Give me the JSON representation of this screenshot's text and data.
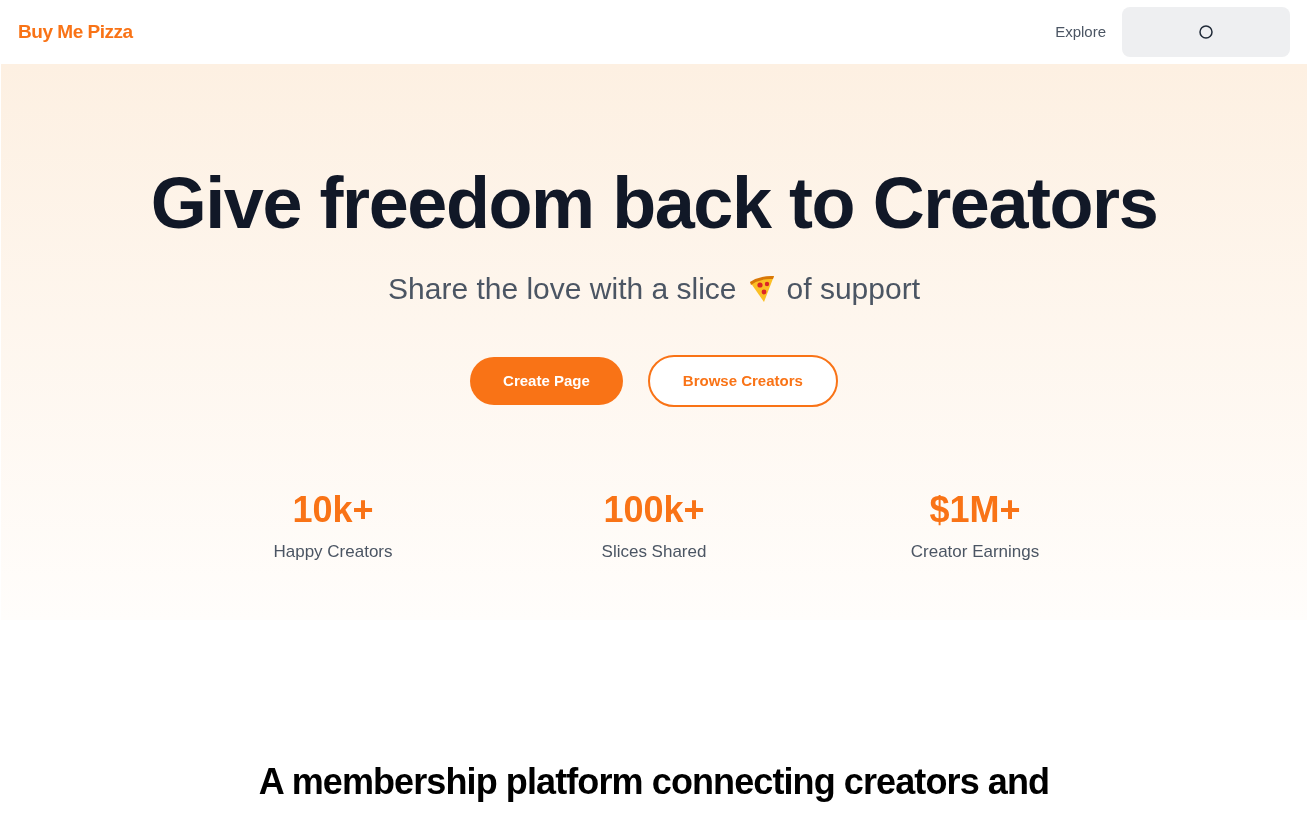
{
  "header": {
    "logo": "Buy Me Pizza",
    "nav_links": [
      "Explore"
    ]
  },
  "hero": {
    "title": "Give freedom back to Creators",
    "subtitle": {
      "before_icon": "Share the love with a slice",
      "after_icon": "of support"
    },
    "buttons": [
      {
        "label": "Create Page",
        "kind": "primary"
      },
      {
        "label": "Browse Creators",
        "kind": "outline"
      }
    ],
    "stats": [
      {
        "value": "10k+",
        "label": "Happy Creators"
      },
      {
        "value": "100k+",
        "label": "Slices Shared"
      },
      {
        "value": "$1M+",
        "label": "Creator Earnings"
      }
    ]
  },
  "section": {
    "heading": "A membership platform connecting creators and"
  }
}
